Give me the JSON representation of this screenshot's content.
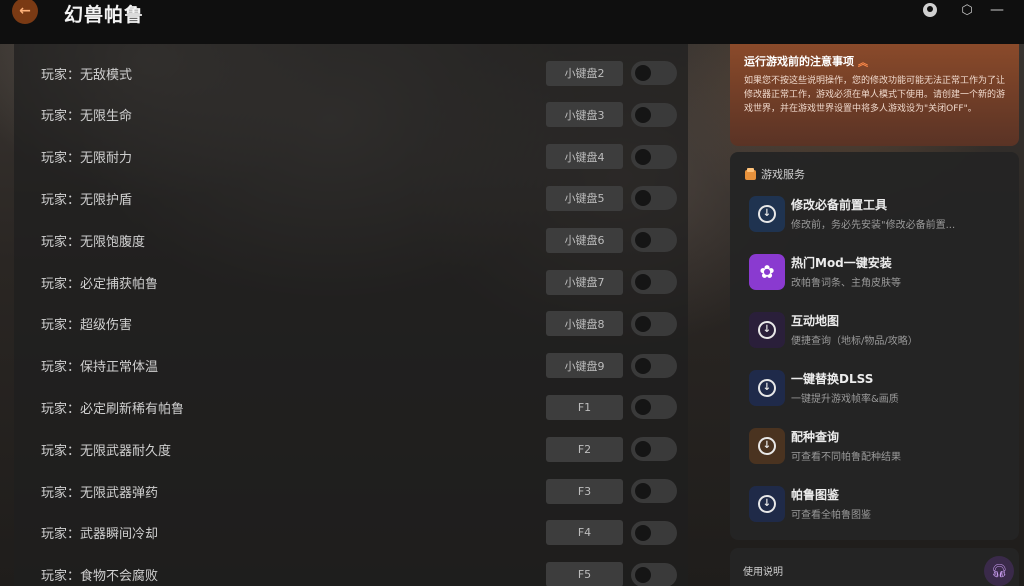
{
  "app": {
    "title": "幻兽帕鲁",
    "back_icon": "arrow-left-icon",
    "accent": "#7a3a14"
  },
  "titlebar_icons": [
    "user-icon",
    "settings-icon",
    "minimize-icon"
  ],
  "cheats": [
    {
      "label": "玩家：无敌模式",
      "key": "小键盘2",
      "enabled": false
    },
    {
      "label": "玩家：无限生命",
      "key": "小键盘3",
      "enabled": false
    },
    {
      "label": "玩家：无限耐力",
      "key": "小键盘4",
      "enabled": false
    },
    {
      "label": "玩家：无限护盾",
      "key": "小键盘5",
      "enabled": false
    },
    {
      "label": "玩家：无限饱腹度",
      "key": "小键盘6",
      "enabled": false
    },
    {
      "label": "玩家：必定捕获帕鲁",
      "key": "小键盘7",
      "enabled": false
    },
    {
      "label": "玩家：超级伤害",
      "key": "小键盘8",
      "enabled": false
    },
    {
      "label": "玩家：保持正常体温",
      "key": "小键盘9",
      "enabled": false
    },
    {
      "label": "玩家：必定刷新稀有帕鲁",
      "key": "F1",
      "enabled": false
    },
    {
      "label": "玩家：无限武器耐久度",
      "key": "F2",
      "enabled": false
    },
    {
      "label": "玩家：无限武器弹药",
      "key": "F3",
      "enabled": false
    },
    {
      "label": "玩家：武器瞬间冷却",
      "key": "F4",
      "enabled": false
    },
    {
      "label": "玩家：食物不会腐败",
      "key": "F5",
      "enabled": false
    }
  ],
  "notice": {
    "title": "运行游戏前的注意事项",
    "text": "如果您不按这些说明操作，您的修改功能可能无法正常工作为了让修改器正常工作，游戏必须在单人模式下使用。请创建一个新的游戏世界，并在游戏世界设置中将多人游戏设为\"关闭OFF\"。"
  },
  "services": {
    "header": "游戏服务",
    "items": [
      {
        "title": "修改必备前置工具",
        "subtitle": "修改前，务必先安装\"修改必备前置...",
        "icon": "download-icon",
        "color": "#1f3350"
      },
      {
        "title": "热门Mod一键安装",
        "subtitle": "改帕鲁词条、主角皮肤等",
        "icon": "mod-icon",
        "color": "#8a3ad0"
      },
      {
        "title": "互动地图",
        "subtitle": "便捷查询（地标/物品/攻略）",
        "icon": "download-icon",
        "color": "#2a1f3a"
      },
      {
        "title": "一键替换DLSS",
        "subtitle": "一键提升游戏帧率&画质",
        "icon": "download-icon",
        "color": "#1f2a4a"
      },
      {
        "title": "配种查询",
        "subtitle": "可查看不同帕鲁配种结果",
        "icon": "download-icon",
        "color": "#4a3320"
      },
      {
        "title": "帕鲁图鉴",
        "subtitle": "可查看全帕鲁图鉴",
        "icon": "download-icon",
        "color": "#1f2a48"
      }
    ]
  },
  "usage": {
    "label": "使用说明",
    "icon": "headset-icon"
  }
}
